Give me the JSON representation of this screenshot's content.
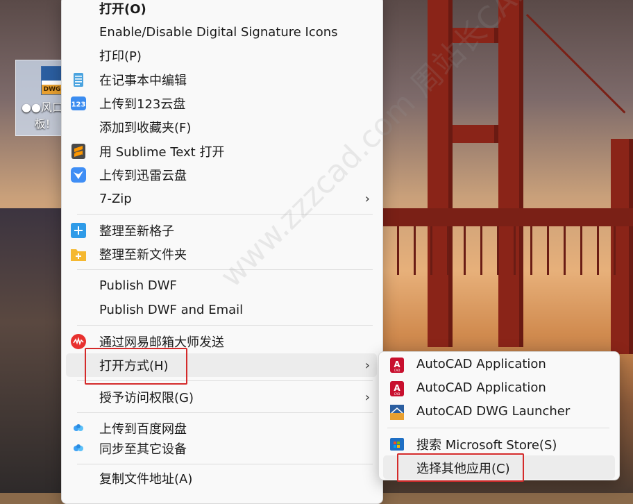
{
  "desktop": {
    "icon_badge": "DWG",
    "icon_label_line1": "●●风口",
    "icon_label_line2": "板!"
  },
  "context_menu": {
    "items": [
      {
        "label": "打开(O)",
        "icon": "none",
        "bold": true
      },
      {
        "label": "Enable/Disable Digital Signature Icons",
        "icon": "none"
      },
      {
        "label": "打印(P)",
        "icon": "none"
      },
      {
        "label": "在记事本中编辑",
        "icon": "notepad-icon"
      },
      {
        "label": "上传到123云盘",
        "icon": "123-cloud-icon"
      },
      {
        "label": "添加到收藏夹(F)",
        "icon": "none"
      },
      {
        "label": "用 Sublime Text 打开",
        "icon": "sublime-icon"
      },
      {
        "label": "上传到迅雷云盘",
        "icon": "xunlei-icon"
      },
      {
        "label": "7-Zip",
        "icon": "none",
        "submenu": true
      },
      {
        "label": "整理至新格子",
        "icon": "plus-tile-icon"
      },
      {
        "label": "整理至新文件夹",
        "icon": "plus-folder-icon"
      },
      {
        "label": "Publish DWF",
        "icon": "none"
      },
      {
        "label": "Publish DWF and Email",
        "icon": "none"
      },
      {
        "label": "通过网易邮箱大师发送",
        "icon": "netease-mail-icon"
      },
      {
        "label": "打开方式(H)",
        "icon": "none",
        "submenu": true
      },
      {
        "label": "授予访问权限(G)",
        "icon": "none",
        "submenu": true
      },
      {
        "label": "上传到百度网盘",
        "icon": "baidu-cloud-icon"
      },
      {
        "label": "同步至其它设备",
        "icon": "baidu-sync-icon"
      },
      {
        "label": "复制文件地址(A)",
        "icon": "none"
      }
    ],
    "arrow_glyph": "›"
  },
  "open_with_submenu": {
    "items": [
      {
        "label": "AutoCAD Application",
        "icon": "autocad-icon"
      },
      {
        "label": "AutoCAD Application",
        "icon": "autocad-icon"
      },
      {
        "label": "AutoCAD DWG Launcher",
        "icon": "dwg-launcher-icon"
      },
      {
        "label": "搜索 Microsoft Store(S)",
        "icon": "microsoft-store-icon"
      },
      {
        "label": "选择其他应用(C)",
        "icon": "none"
      }
    ]
  },
  "watermark": "www.zzzcad.com 周站长CAD",
  "colors": {
    "highlight": "#d42a2a",
    "menu_bg": "#f9f9f9",
    "hover_bg": "#ececec"
  }
}
